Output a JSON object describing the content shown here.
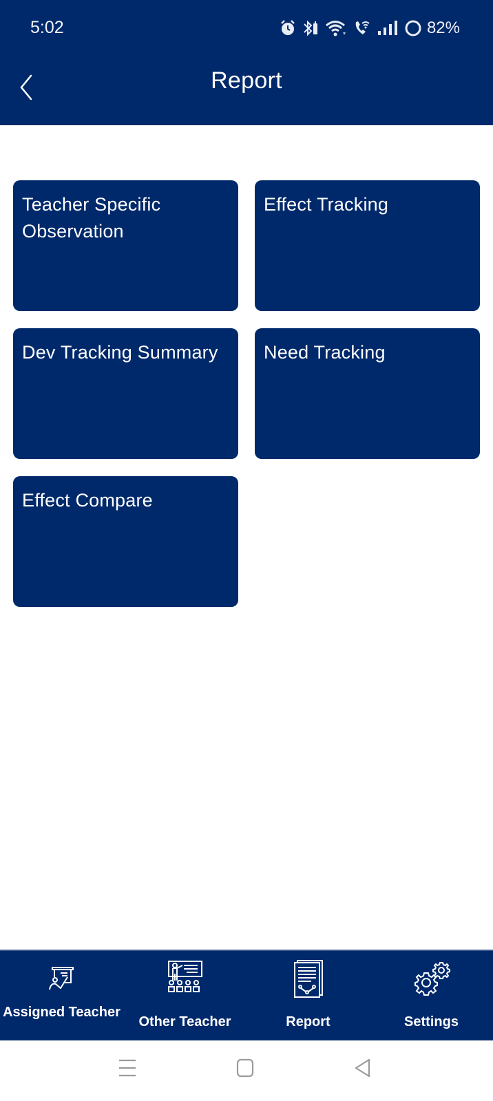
{
  "status_bar": {
    "time": "5:02",
    "battery_percent": "82%",
    "icons": [
      "alarm-icon",
      "bluetooth-icon",
      "wifi-icon",
      "wifi-calling-icon",
      "signal-icon",
      "battery-ring-icon"
    ]
  },
  "header": {
    "title": "Report",
    "back_icon": "chevron-left-icon"
  },
  "cards": [
    {
      "label": "Teacher Specific Observation"
    },
    {
      "label": "Effect Tracking"
    },
    {
      "label": "Dev Tracking Summary"
    },
    {
      "label": "Need Tracking"
    },
    {
      "label": "Effect Compare"
    }
  ],
  "bottom_nav": {
    "items": [
      {
        "label": "Assigned Teacher",
        "icon": "assigned-teacher-icon"
      },
      {
        "label": "Other Teacher",
        "icon": "classroom-teacher-icon"
      },
      {
        "label": "Report",
        "icon": "report-document-icon"
      },
      {
        "label": "Settings",
        "icon": "gears-icon"
      }
    ]
  },
  "system_nav": {
    "buttons": [
      "recents-icon",
      "home-icon",
      "back-triangle-icon"
    ]
  },
  "colors": {
    "primary": "#00296B",
    "background": "#FFFFFF",
    "text_on_primary": "#FFFFFF",
    "system_icon": "#9A9A9A"
  }
}
